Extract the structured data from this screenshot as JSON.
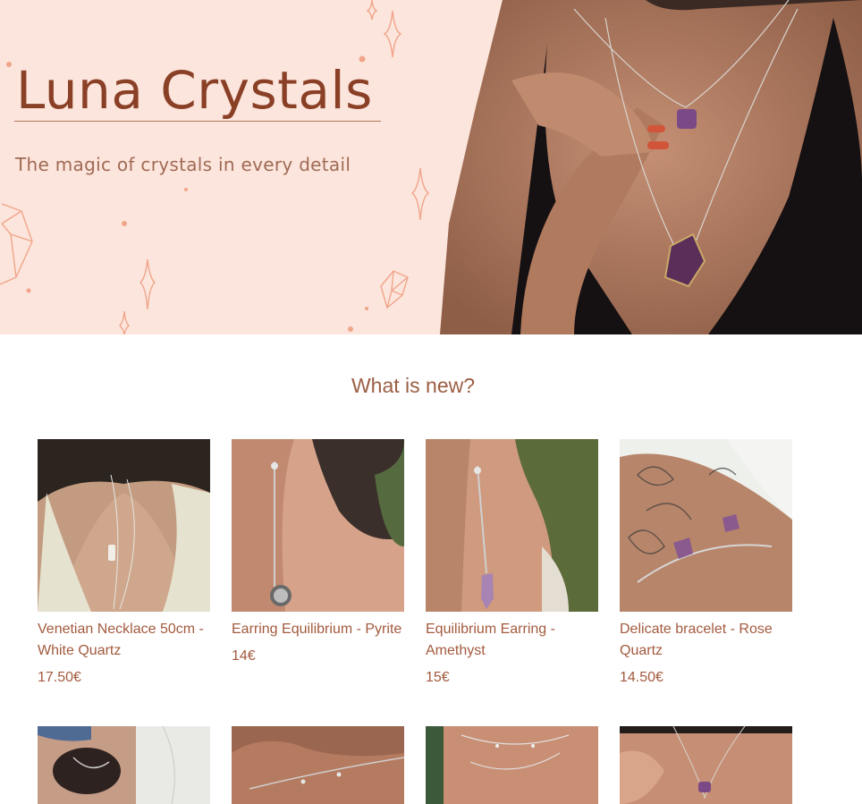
{
  "hero": {
    "brand": "Luna Crystals",
    "tagline": "The magic of crystals in every detail"
  },
  "section": {
    "title": "What is new?"
  },
  "products": [
    {
      "name": "Venetian Necklace 50cm - White Quartz",
      "price": "17.50€"
    },
    {
      "name": "Earring Equilibrium - Pyrite",
      "price": "14€"
    },
    {
      "name": "Equilibrium Earring - Amethyst",
      "price": "15€"
    },
    {
      "name": "Delicate bracelet - Rose Quartz",
      "price": "14.50€"
    }
  ],
  "colors": {
    "hero_bg": "#fce5dc",
    "brand": "#8a4026",
    "text_accent": "#a35a3e"
  }
}
